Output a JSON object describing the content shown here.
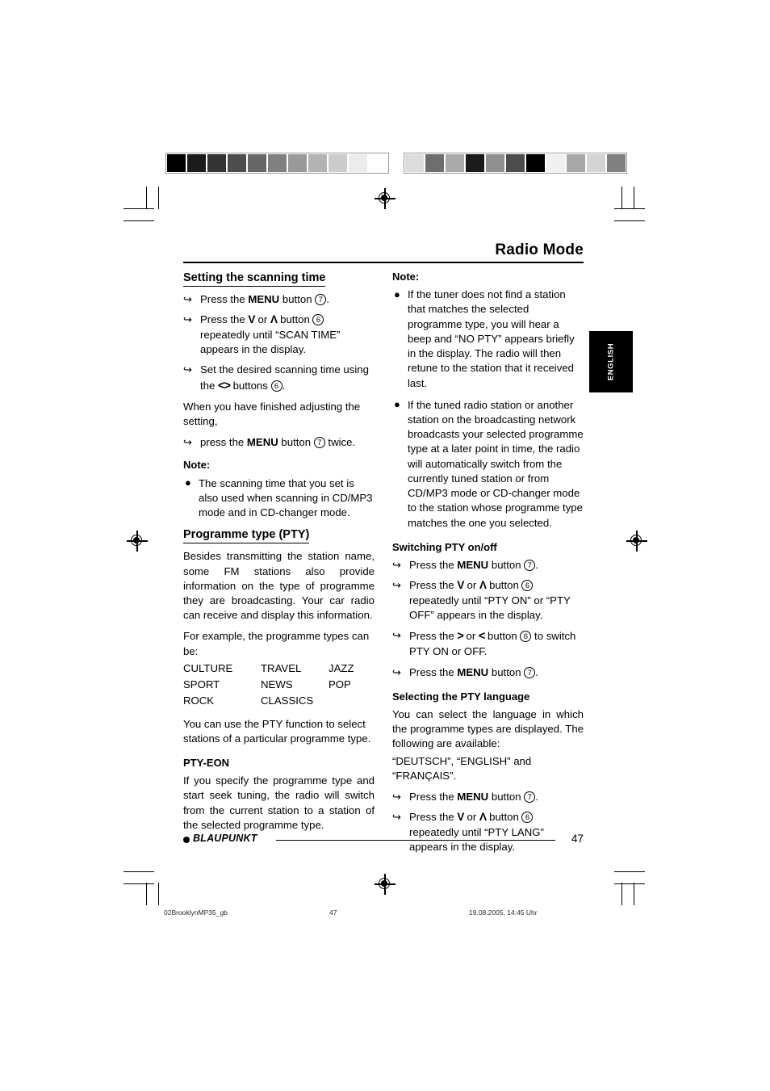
{
  "page": {
    "title": "Radio Mode",
    "number": "47",
    "language_tab": "ENGLISH"
  },
  "calibration": {
    "left_bar": [
      "#000000",
      "#1a1a1a",
      "#333333",
      "#4d4d4d",
      "#666666",
      "#808080",
      "#999999",
      "#b3b3b3",
      "#cccccc",
      "#ececec",
      "#ffffff"
    ],
    "right_bar": [
      "#dcdcdc",
      "#6e6e6e",
      "#aaaaaa",
      "#1a1a1a",
      "#909090",
      "#4d4d4d",
      "#000000",
      "#f0f0f0",
      "#a8a8a8",
      "#d4d4d4",
      "#808080"
    ]
  },
  "glyphs": {
    "arrow_step": "↪",
    "bullet": "●",
    "down": "V",
    "up": "Λ",
    "left": "<",
    "right": ">"
  },
  "left_column": {
    "heading_scanning": "Setting the scanning time",
    "steps_scanning": [
      {
        "pre": "Press the ",
        "bold": "MENU",
        "mid": " button ",
        "circle": "7",
        "post": "."
      },
      {
        "pre": "Press the ",
        "glyph_down": "V",
        "mid2": " or ",
        "glyph_up": "Λ",
        "mid": " button ",
        "circle": "6",
        "post": " repeatedly until “SCAN TIME” appears in the display."
      },
      {
        "pre": "Set the desired scanning time using the ",
        "glyph_lr": "<>",
        "mid": " buttons ",
        "circle": "6",
        "post": "."
      }
    ],
    "finished_text": "When you have finished adjusting the setting,",
    "step_press_menu_twice": {
      "pre": "press the ",
      "bold": "MENU",
      "mid": " button ",
      "circle": "7",
      "post": " twice."
    },
    "note_label": "Note:",
    "note_items": [
      "The scanning time that you set is also used when scanning in CD/MP3 mode and in CD-changer mode."
    ],
    "heading_pty": "Programme type (PTY)",
    "pty_intro": "Besides transmitting the station name, some FM stations also provide information on the type of programme they are broadcasting. Your car radio can receive and display this information.",
    "pty_example_intro": "For example, the programme types can be:",
    "pty_types": [
      [
        "CULTURE",
        "TRAVEL",
        "JAZZ"
      ],
      [
        "SPORT",
        "NEWS",
        "POP"
      ],
      [
        "ROCK",
        "CLASSICS",
        ""
      ]
    ],
    "pty_usage": "You can use the PTY function to select stations of a particular programme type.",
    "heading_pty_eon": "PTY-EON",
    "pty_eon_text": "If you specify the programme type and start seek tuning, the radio will switch from the current station to a station of the selected programme type."
  },
  "right_column": {
    "note_label": "Note:",
    "note_items": [
      "If the tuner does not find a station that matches the selected programme type, you will hear a beep and “NO PTY” appears briefly in the display. The radio will then retune to the station that it received last.",
      "If the tuned radio station or another station on the broadcasting network broadcasts your selected programme type at a later point in time, the radio will automatically switch from the currently tuned station or from CD/MP3 mode or CD-changer mode to the station whose programme type matches the one you selected."
    ],
    "heading_switching": "Switching PTY on/off",
    "steps_switching": [
      {
        "pre": "Press the ",
        "bold": "MENU",
        "mid": " button ",
        "circle": "7",
        "post": "."
      },
      {
        "pre": "Press the ",
        "glyph_down": "V",
        "mid2": " or ",
        "glyph_up": "Λ",
        "mid": " button ",
        "circle": "6",
        "post": " repeatedly until “PTY ON” or “PTY OFF” appears in the display."
      },
      {
        "pre": "Press the ",
        "glyph_right": ">",
        "mid2": " or ",
        "glyph_left": "<",
        "mid": " button ",
        "circle": "6",
        "post": " to switch PTY ON or OFF."
      },
      {
        "pre": "Press the ",
        "bold": "MENU",
        "mid": " button ",
        "circle": "7",
        "post": "."
      }
    ],
    "heading_language": "Selecting the PTY language",
    "language_intro": "You can select the language in which the programme types are displayed. The following are available:",
    "language_options": "“DEUTSCH”, “ENGLISH” and “FRANÇAIS”.",
    "steps_language": [
      {
        "pre": "Press the ",
        "bold": "MENU",
        "mid": " button ",
        "circle": "7",
        "post": "."
      },
      {
        "pre": "Press the ",
        "glyph_down": "V",
        "mid2": " or ",
        "glyph_up": "Λ",
        "mid": " button ",
        "circle": "6",
        "post": " repeatedly until “PTY LANG” appears in the display."
      }
    ]
  },
  "footer": {
    "brand": "BLAUPUNKT",
    "page_number": "47"
  },
  "slug": {
    "file": "02BrooklynMP35_gb",
    "page": "47",
    "date": "19.08.2005, 14:45 Uhr"
  }
}
